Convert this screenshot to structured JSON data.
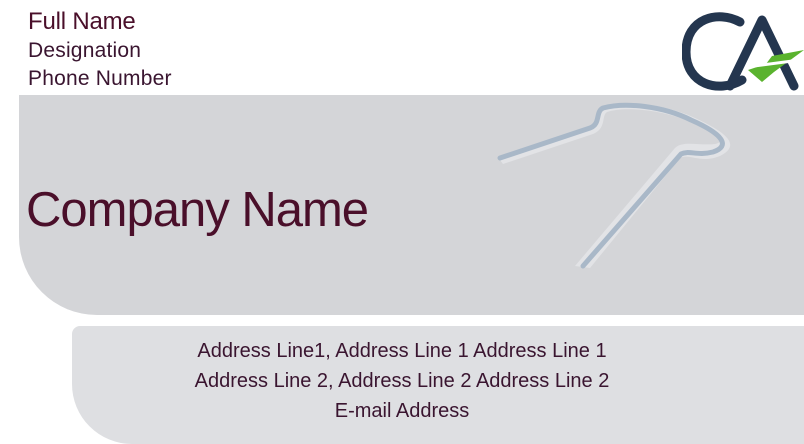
{
  "contact": {
    "full_name": "Full Name",
    "designation": "Designation",
    "phone": "Phone Number"
  },
  "company": {
    "name": "Company Name"
  },
  "address": {
    "line1": "Address Line1, Address Line 1 Address Line 1",
    "line2": "Address Line 2, Address Line 2 Address Line 2",
    "email": "E-mail Address"
  },
  "logo": {
    "icon": "ca-logo-icon",
    "letters": "CA",
    "primary_color": "#24364f",
    "accent_color": "#5ab32e"
  },
  "colors": {
    "text": "#4a0f2a",
    "band": "#d4d5d8",
    "address_band": "#dedfe2",
    "decor": "#a9b8c8"
  }
}
